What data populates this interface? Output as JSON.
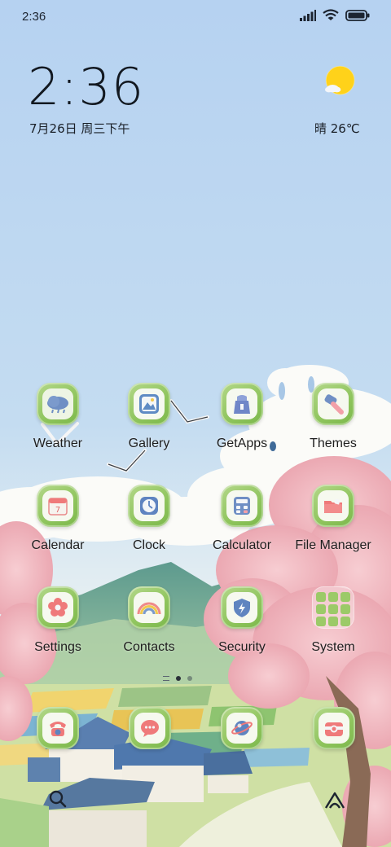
{
  "status_bar": {
    "time": "2:36",
    "icons": [
      "signal-icon",
      "wifi-icon",
      "battery-icon"
    ]
  },
  "clock_widget": {
    "time": "2:36",
    "date": "7月26日 周三下午",
    "weather": "晴 26℃",
    "weather_icon": "sun-with-cloud-icon"
  },
  "apps": [
    {
      "label": "Weather",
      "icon": "cloud-rain-icon"
    },
    {
      "label": "Gallery",
      "icon": "picture-icon"
    },
    {
      "label": "GetApps",
      "icon": "shopping-bag-icon"
    },
    {
      "label": "Themes",
      "icon": "paint-brush-icon"
    },
    {
      "label": "Calendar",
      "icon": "calendar-icon"
    },
    {
      "label": "Clock",
      "icon": "clock-icon"
    },
    {
      "label": "Calculator",
      "icon": "calculator-icon"
    },
    {
      "label": "File Manager",
      "icon": "folder-icon"
    },
    {
      "label": "Settings",
      "icon": "flower-gear-icon"
    },
    {
      "label": "Contacts",
      "icon": "rainbow-icon"
    },
    {
      "label": "Security",
      "icon": "shield-bolt-icon"
    },
    {
      "label": "System",
      "icon": "folder-grid-icon"
    }
  ],
  "dock": [
    {
      "icon": "phone-icon"
    },
    {
      "icon": "message-icon"
    },
    {
      "icon": "browser-icon"
    },
    {
      "icon": "camera-icon"
    }
  ],
  "pager": {
    "pages": 2,
    "active": 1
  },
  "bottom": {
    "left_icon": "search-icon",
    "right_icon": "app-vault-icon"
  },
  "colors": {
    "sky": "#b8d4f0",
    "tile_green": "#8ec45c",
    "sakura": "#f2b8c0",
    "sun": "#ffd21a"
  }
}
